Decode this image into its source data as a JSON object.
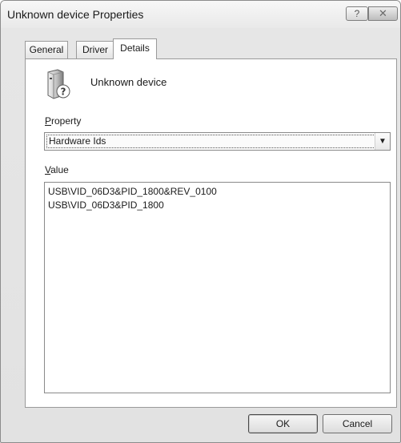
{
  "window": {
    "title": "Unknown device Properties",
    "help_glyph": "?",
    "close_glyph": "✕"
  },
  "tabs": [
    {
      "label": "General",
      "active": false
    },
    {
      "label": "Driver",
      "active": false
    },
    {
      "label": "Details",
      "active": true
    }
  ],
  "details": {
    "device_name": "Unknown device",
    "device_icon": "unknown-device-icon",
    "property_label_mnemonic": "P",
    "property_label_rest": "roperty",
    "property_selected": "Hardware Ids",
    "value_label_mnemonic": "V",
    "value_label_rest": "alue",
    "values": [
      "USB\\VID_06D3&PID_1800&REV_0100",
      "USB\\VID_06D3&PID_1800"
    ]
  },
  "buttons": {
    "ok": "OK",
    "cancel": "Cancel"
  }
}
